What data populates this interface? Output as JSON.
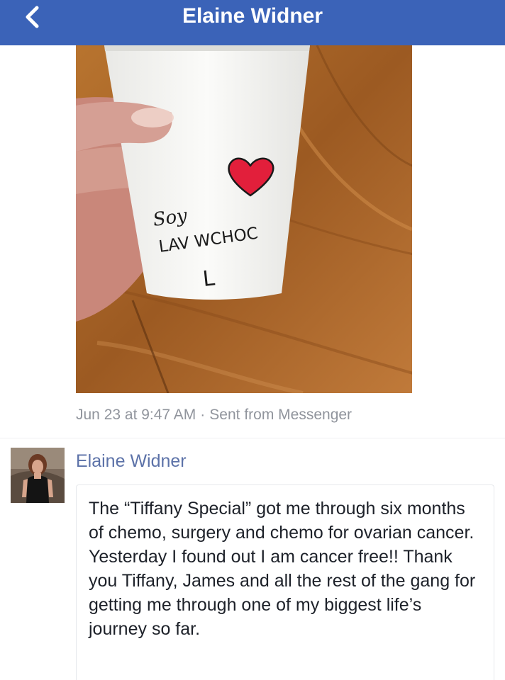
{
  "header": {
    "title": "Elaine Widner",
    "back_icon": "chevron-left-icon",
    "background_color": "#3b63b8"
  },
  "post": {
    "photo_alt": "Hand holding a white paper cup with a red heart drawn on it",
    "cup_writing": {
      "line1": "Soy",
      "line2": "LAV WCHOC",
      "line3": "L"
    },
    "date": "Jun 23 at 9:47 AM",
    "separator": "·",
    "source": "Sent from Messenger"
  },
  "comment": {
    "author": "Elaine Widner",
    "text": "The “Tiffany Special” got me through six months of chemo, surgery and chemo for ovarian cancer. Yesterday I found out I am cancer free!! Thank you Tiffany, James and all the rest of the gang for getting me through one of my biggest life’s journey so far."
  },
  "colors": {
    "meta_text": "#90949c",
    "author_name": "#5c72a8",
    "body_text": "#1d2129"
  }
}
